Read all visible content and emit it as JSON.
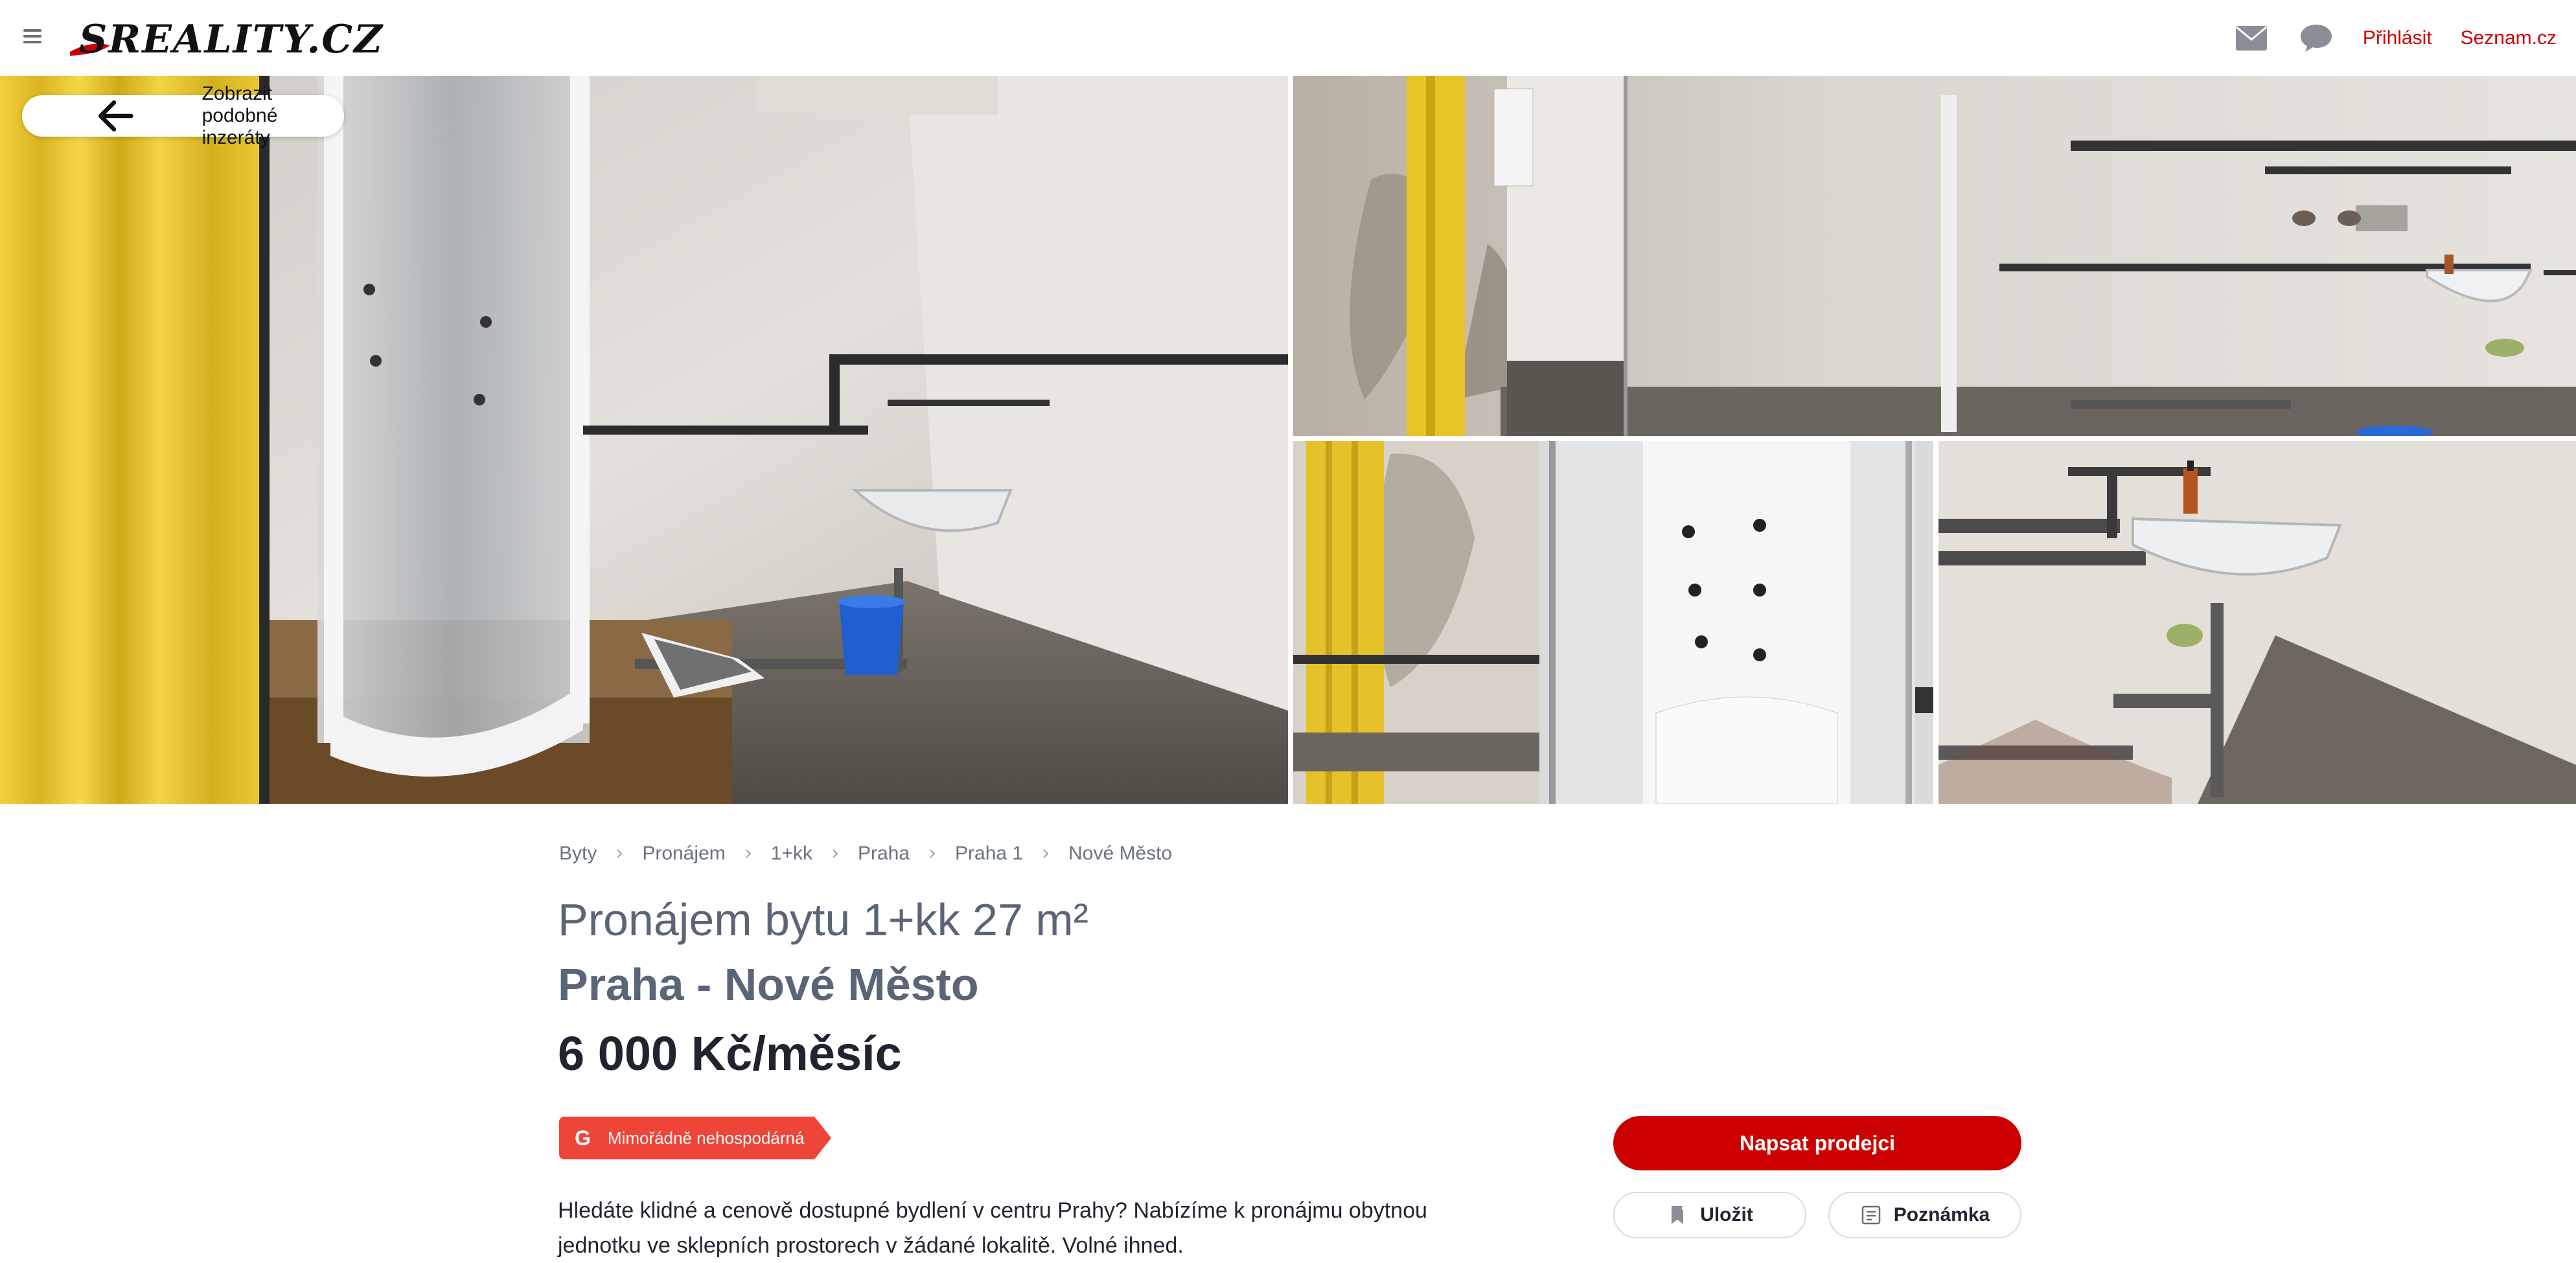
{
  "header": {
    "logo_text": "SREALITY.CZ",
    "login_label": "Přihlásit",
    "seznam_label": "Seznam.cz",
    "icons": [
      "menu-icon",
      "mail-icon",
      "chat-icon"
    ]
  },
  "gallery": {
    "back_label": "Zobrazit podobné inzeráty",
    "photo_count_shown": 4
  },
  "breadcrumb": [
    "Byty",
    "Pronájem",
    "1+kk",
    "Praha",
    "Praha 1",
    "Nové Město"
  ],
  "listing": {
    "title_line1": "Pronájem bytu 1+kk 27 m²",
    "title_line2": "Praha - Nové Město",
    "price": "6 000 Kč/měsíc",
    "energy_class": "G",
    "energy_label": "Mimořádně nehospodárná",
    "description": "Hledáte klidné a cenově dostupné bydlení v centru Prahy? Nabízíme k pronájmu obytnou jednotku ve sklepních prostorech v žádané lokalitě. Volné ihned."
  },
  "actions": {
    "contact_label": "Napsat prodejci",
    "save_label": "Uložit",
    "note_label": "Poznámka"
  },
  "colors": {
    "brand_red": "#cc0000",
    "energy_g": "#ef4438",
    "title_gray": "#5a6577"
  }
}
